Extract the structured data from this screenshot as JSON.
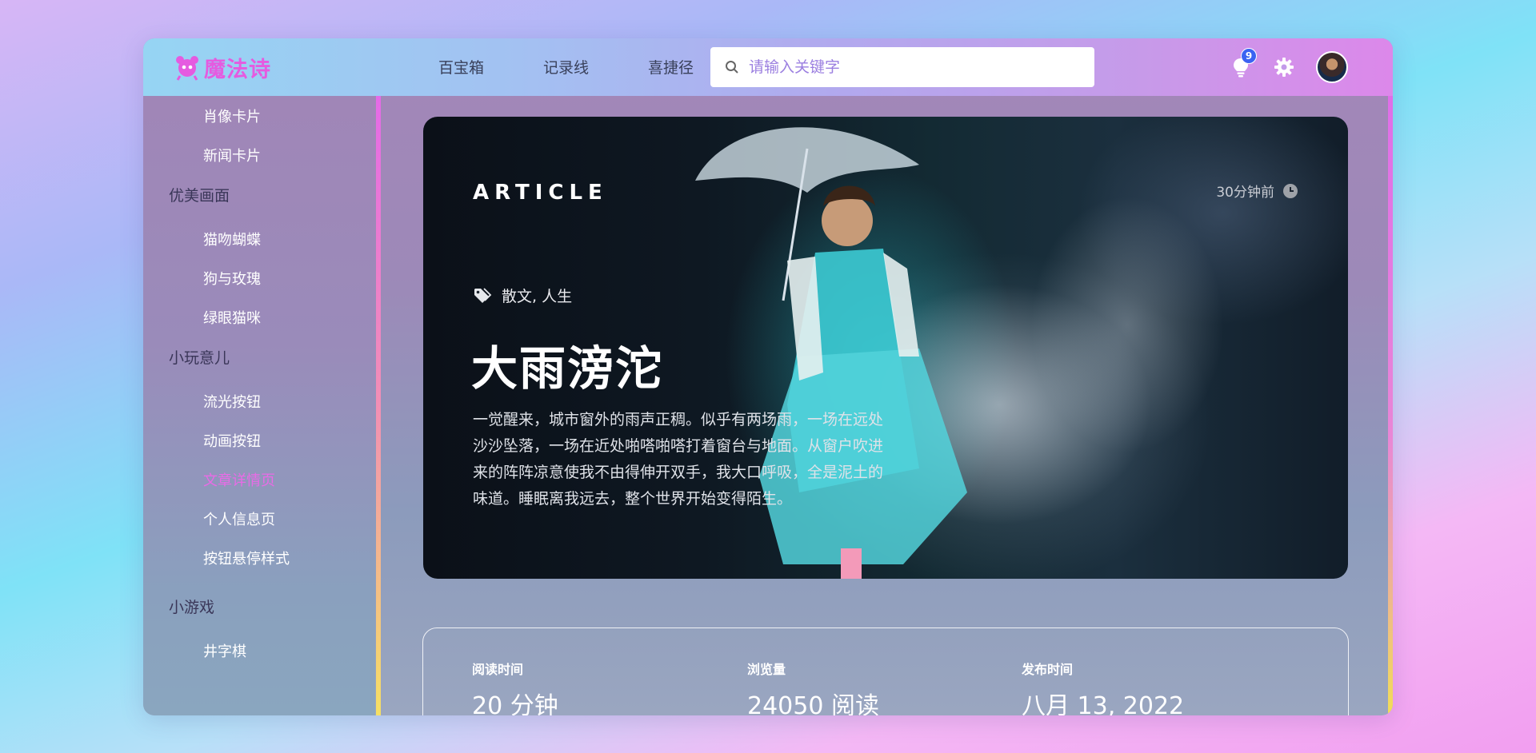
{
  "app": {
    "logo_text": "魔法诗",
    "brand_color": "#e55be0"
  },
  "nav": {
    "items": [
      "百宝箱",
      "记录线",
      "喜捷径"
    ]
  },
  "search": {
    "placeholder": "请输入关键字",
    "value": ""
  },
  "notifications": {
    "count": "9"
  },
  "sidebar": {
    "items_top": [
      "肖像卡片",
      "新闻卡片"
    ],
    "groups": [
      {
        "title": "优美画面",
        "items": [
          "猫吻蝴蝶",
          "狗与玫瑰",
          "绿眼猫咪"
        ]
      },
      {
        "title": "小玩意儿",
        "items": [
          "流光按钮",
          "动画按钮",
          "文章详情页",
          "个人信息页",
          "按钮悬停样式"
        ]
      },
      {
        "title": "小游戏",
        "items": [
          "井字棋"
        ]
      }
    ],
    "active_item": "文章详情页",
    "active_color": "#e96be6"
  },
  "article": {
    "label": "ARTICLE",
    "time_ago": "30分钟前",
    "tags": "散文, 人生",
    "title": "大雨滂沱",
    "description": "一觉醒来，城市窗外的雨声正稠。似乎有两场雨，一场在远处沙沙坠落，一场在近处啪嗒啪嗒打着窗台与地面。从窗户吹进来的阵阵凉意使我不由得伸开双手，我大口呼吸，全是泥土的味道。睡眠离我远去，整个世界开始变得陌生。"
  },
  "stats": [
    {
      "label": "阅读时间",
      "value": "20 分钟"
    },
    {
      "label": "浏览量",
      "value": "24050 阅读"
    },
    {
      "label": "发布时间",
      "value": "八月 13, 2022"
    }
  ]
}
